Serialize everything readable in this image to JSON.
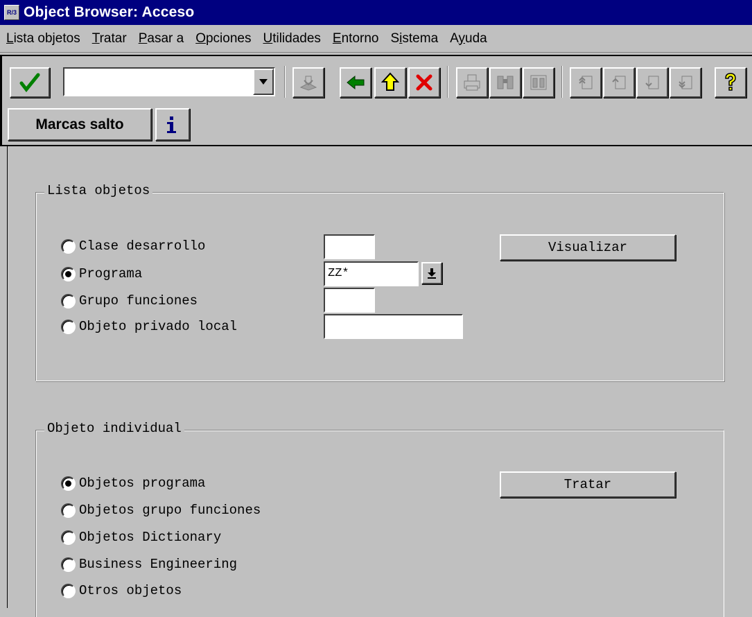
{
  "window": {
    "title": "Object Browser: Acceso",
    "app_icon": "R/3"
  },
  "menu": [
    {
      "pre": "",
      "u": "L",
      "post": "ista objetos"
    },
    {
      "pre": "",
      "u": "T",
      "post": "ratar"
    },
    {
      "pre": "",
      "u": "P",
      "post": "asar a"
    },
    {
      "pre": "",
      "u": "O",
      "post": "pciones"
    },
    {
      "pre": "",
      "u": "U",
      "post": "tilidades"
    },
    {
      "pre": "",
      "u": "E",
      "post": "ntorno"
    },
    {
      "pre": "S",
      "u": "i",
      "post": "stema"
    },
    {
      "pre": "A",
      "u": "y",
      "post": "uda"
    }
  ],
  "toolbar": {
    "command_value": "",
    "icons": [
      "enter-checkmark-icon",
      "save-icon",
      "back-arrow-icon",
      "exit-up-arrow-icon",
      "cancel-x-icon",
      "print-icon",
      "find-icon",
      "find-next-icon",
      "first-page-icon",
      "previous-page-icon",
      "next-page-icon",
      "last-page-icon",
      "help-question-icon"
    ]
  },
  "app_toolbar": {
    "bookmarks_label": "Marcas salto",
    "info_icon": "info-icon"
  },
  "lista_objetos": {
    "title": "Lista objetos",
    "options": [
      {
        "label": "Clase desarrollo",
        "selected": false
      },
      {
        "label": "Programa",
        "selected": true
      },
      {
        "label": "Grupo funciones",
        "selected": false
      },
      {
        "label": "Objeto privado local",
        "selected": false
      }
    ],
    "fields": {
      "clase_desarrollo": "",
      "programa": "ZZ*",
      "grupo_funciones": "",
      "objeto_privado_local": ""
    },
    "button_label": "Visualizar"
  },
  "objeto_individual": {
    "title": "Objeto individual",
    "options": [
      {
        "label": "Objetos programa",
        "selected": true
      },
      {
        "label": "Objetos grupo funciones",
        "selected": false
      },
      {
        "label": "Objetos Dictionary",
        "selected": false
      },
      {
        "label": "Business Engineering",
        "selected": false
      },
      {
        "label": "Otros objetos",
        "selected": false
      }
    ],
    "button_label": "Tratar"
  },
  "colors": {
    "window_bg": "#c0c0c0",
    "title_bar": "#000080",
    "enter_green": "#008000",
    "cancel_red": "#e00000",
    "help_yellow": "#ffff00"
  }
}
